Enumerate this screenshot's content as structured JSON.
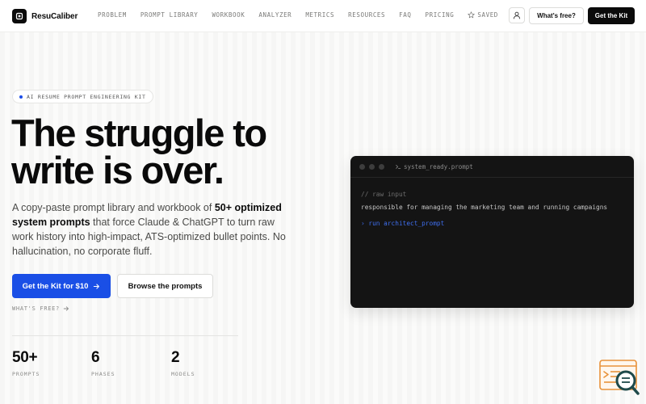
{
  "nav": {
    "brand": "ResuCaliber",
    "links": [
      "PROBLEM",
      "PROMPT LIBRARY",
      "WORKBOOK",
      "ANALYZER",
      "METRICS",
      "RESOURCES",
      "FAQ",
      "PRICING"
    ],
    "saved_label": "SAVED",
    "whats_free": "What's free?",
    "get_kit": "Get the Kit"
  },
  "hero": {
    "badge": "AI RESUME PROMPT ENGINEERING KIT",
    "headline_line1": "The struggle to",
    "headline_line2": "write is over.",
    "sub_pre": "A copy-paste prompt library and workbook of ",
    "sub_bold": "50+ optimized system prompts",
    "sub_post": " that force Claude & ChatGPT to turn raw work history into high-impact, ATS-optimized bullet points. No hallucination, no corporate fluff.",
    "cta_primary": "Get the Kit for $10",
    "cta_secondary": "Browse the prompts",
    "whats_free_link": "WHAT'S FREE?"
  },
  "stats": [
    {
      "value": "50+",
      "label": "PROMPTS"
    },
    {
      "value": "6",
      "label": "PHASES"
    },
    {
      "value": "2",
      "label": "MODELS"
    }
  ],
  "terminal": {
    "title": "system_ready.prompt",
    "comment": "// raw input",
    "input": "responsible for managing the marketing team and running campaigns",
    "command": "› run architect_prompt"
  },
  "colors": {
    "accent": "#1a4fe6",
    "dark": "#0b0b0b",
    "terminal_bg": "#141414"
  }
}
